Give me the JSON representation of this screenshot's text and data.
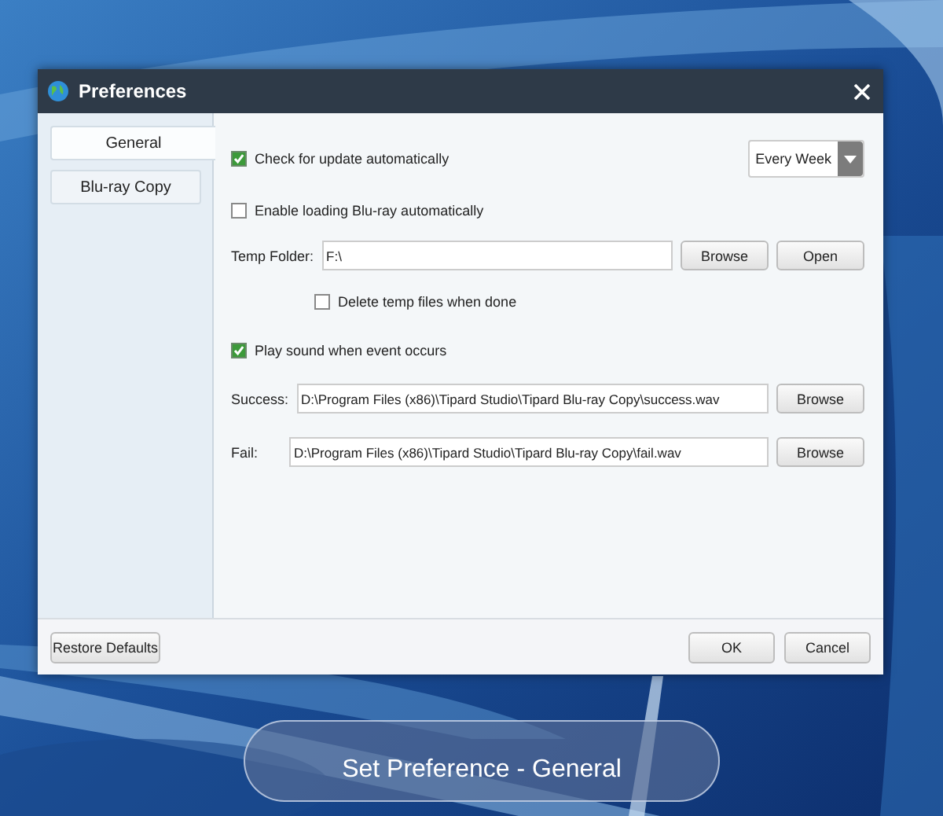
{
  "window": {
    "title": "Preferences"
  },
  "tabs": [
    {
      "label": "General",
      "selected": true
    },
    {
      "label": "Blu-ray Copy",
      "selected": false
    }
  ],
  "general": {
    "auto_update": {
      "label": "Check for update automatically",
      "checked": true,
      "frequency": "Every Week"
    },
    "auto_load": {
      "label": "Enable loading Blu-ray automatically",
      "checked": false
    },
    "temp_folder": {
      "label": "Temp Folder:",
      "value": "F:\\",
      "buttons": [
        "Browse",
        "Open"
      ]
    },
    "delete_temp": {
      "label": "Delete temp files when done",
      "checked": false
    },
    "play_sound": {
      "label": "Play sound when event occurs",
      "checked": true
    },
    "sounds": [
      {
        "label": "Success:",
        "value": "D:\\Program Files (x86)\\Tipard Studio\\Tipard Blu-ray Copy\\success.wav",
        "button": "Browse"
      },
      {
        "label": "Fail:",
        "value": "D:\\Program Files (x86)\\Tipard Studio\\Tipard Blu-ray Copy\\fail.wav",
        "button": "Browse"
      }
    ]
  },
  "footer": {
    "restore": "Restore Defaults",
    "buttons": [
      "OK",
      "Cancel"
    ]
  },
  "caption": "Set Preference - General"
}
